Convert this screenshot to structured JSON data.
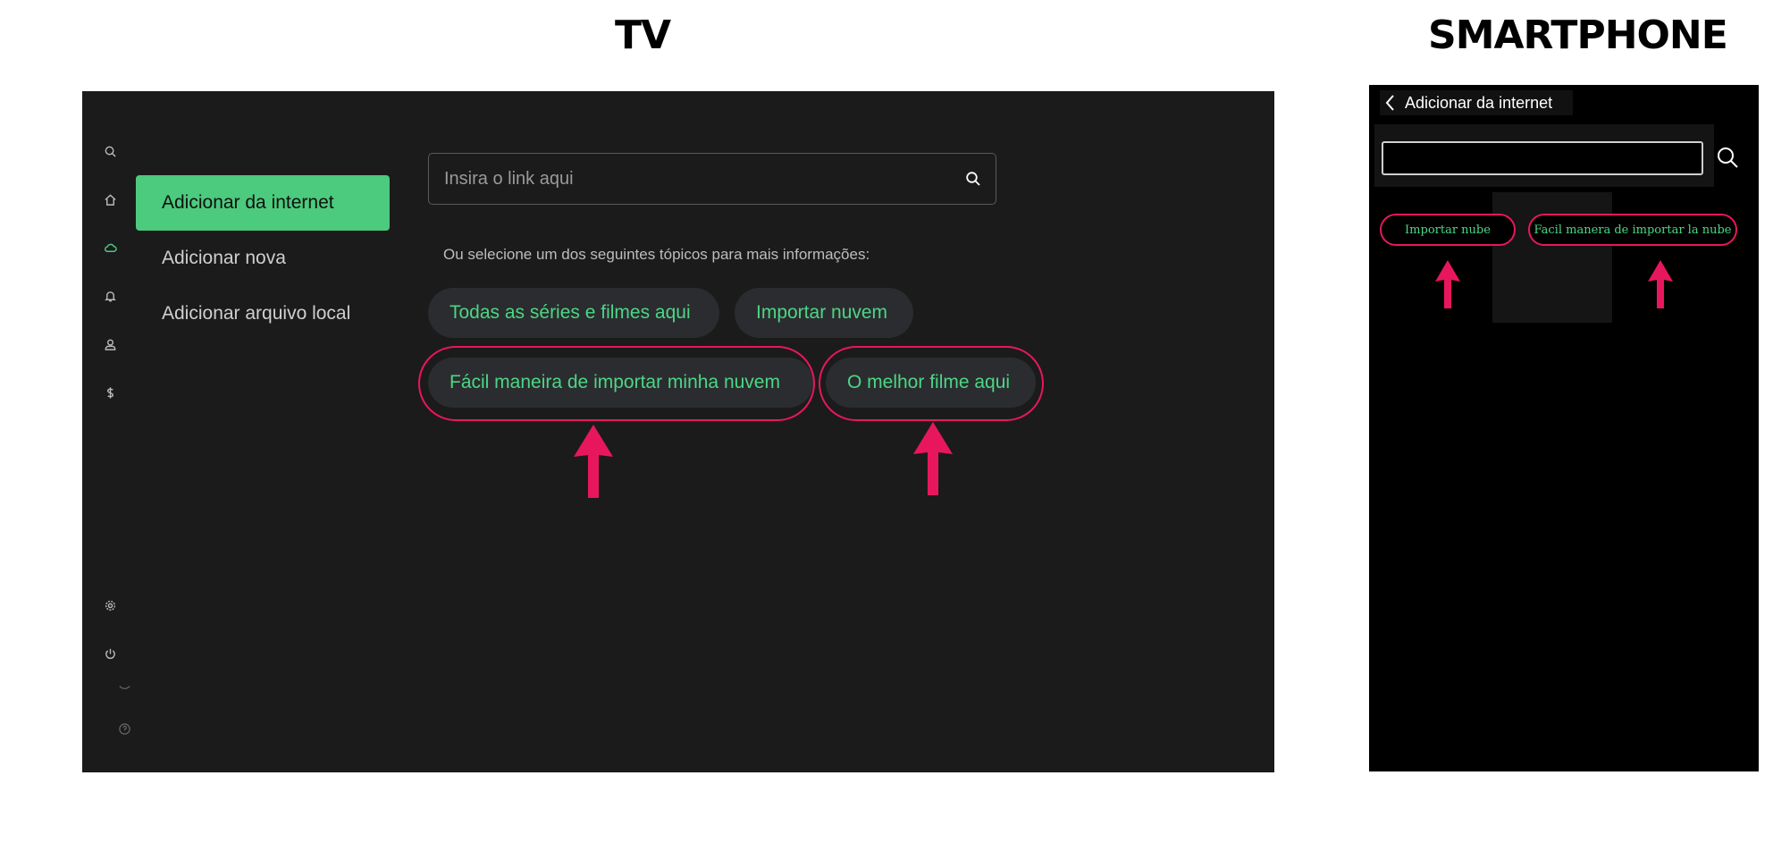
{
  "section_titles": {
    "tv": "TV",
    "smartphone": "SMARTPHONE"
  },
  "tv": {
    "sidebar_icons": [
      "search-icon",
      "home-icon",
      "cloud-icon",
      "bell-icon",
      "user-icon",
      "dollar-icon",
      "settings-icon",
      "power-icon",
      "eye-icon",
      "help-icon"
    ],
    "menu": {
      "items": [
        {
          "label": "Adicionar da internet",
          "active": true
        },
        {
          "label": "Adicionar nova",
          "active": false
        },
        {
          "label": "Adicionar arquivo local",
          "active": false
        }
      ]
    },
    "search": {
      "placeholder": "Insira o link aqui"
    },
    "hint": "Ou selecione um dos seguintes tópicos para mais informações:",
    "chips": [
      "Todas as séries e filmes aqui",
      "Importar nuvem",
      "Fácil maneira de importar minha nuvem",
      "O melhor filme aqui"
    ]
  },
  "phone": {
    "header_title": "Adicionar da internet",
    "chips": [
      "Importar nube",
      "Facil manera de importar la nube"
    ]
  },
  "colors": {
    "accent_green": "#4cca7d",
    "chip_text_green": "#4cd685",
    "highlight_pink": "#e8175d",
    "tv_background": "#1b1b1b",
    "phone_background": "#000000"
  }
}
